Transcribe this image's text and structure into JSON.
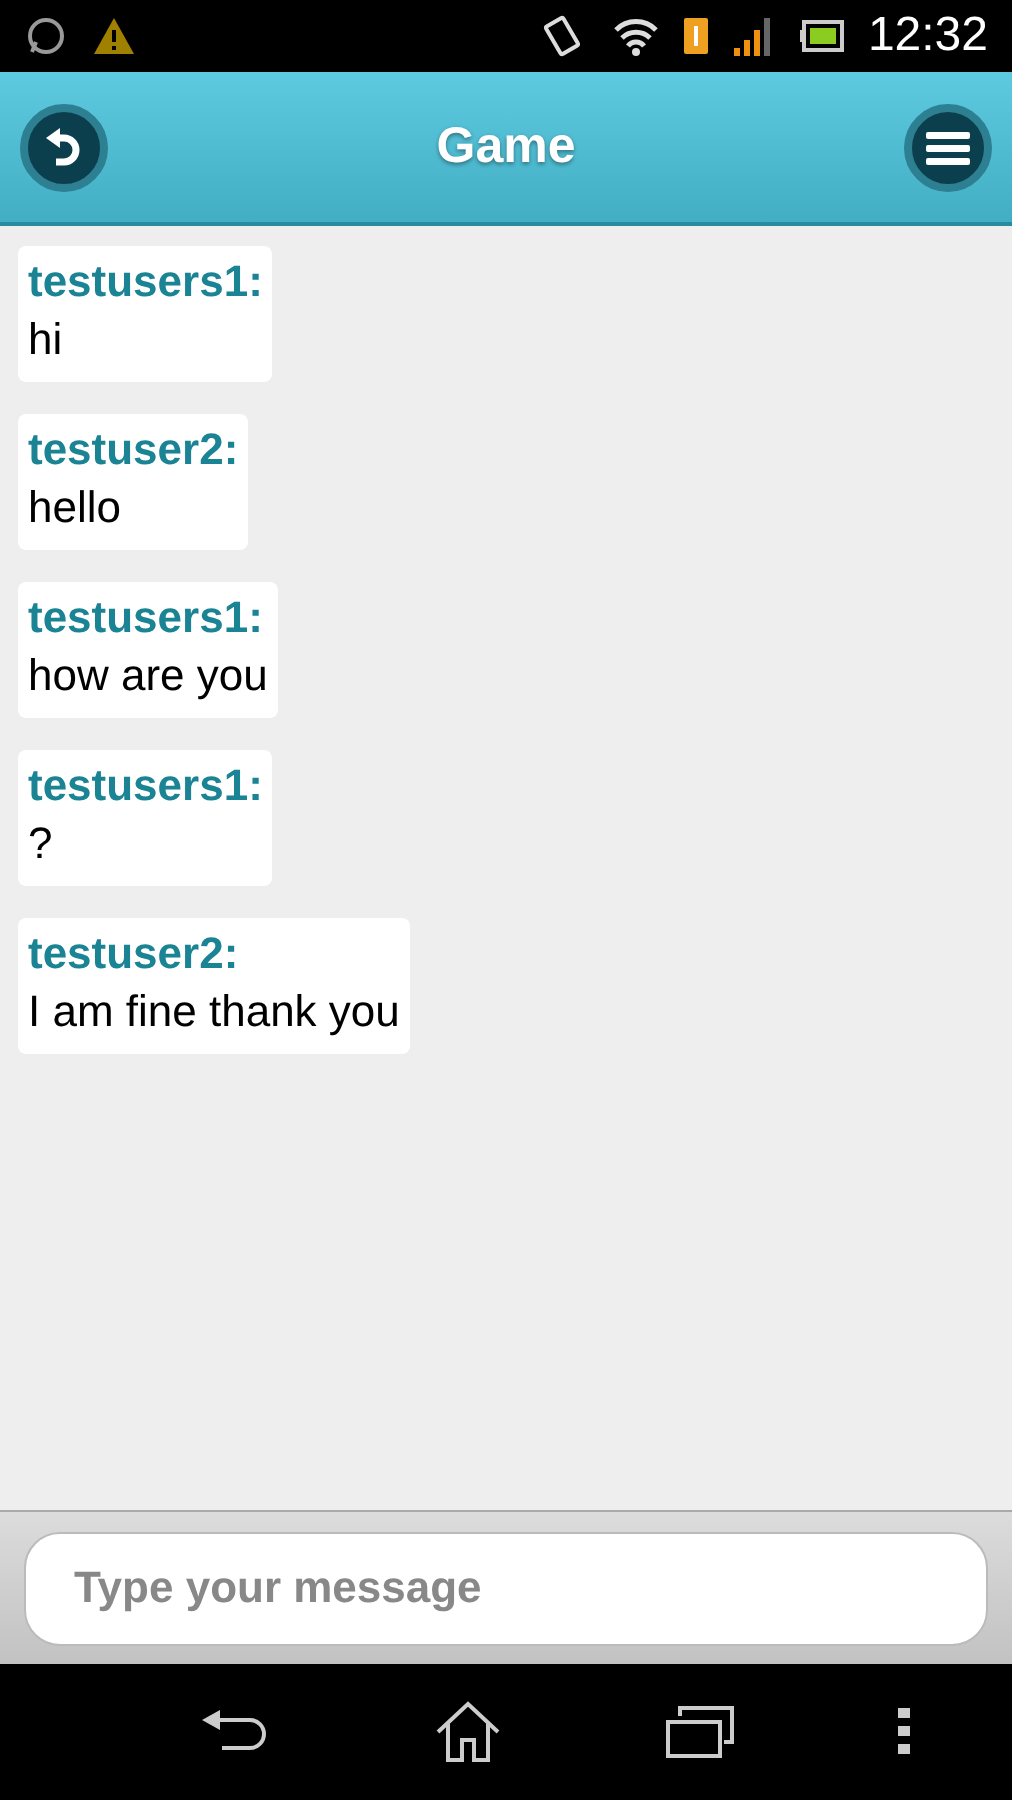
{
  "status_bar": {
    "time": "12:32"
  },
  "header": {
    "title": "Game"
  },
  "messages": [
    {
      "sender": "testusers1:",
      "text": "hi"
    },
    {
      "sender": "testuser2:",
      "text": "hello"
    },
    {
      "sender": "testusers1:",
      "text": "how are you"
    },
    {
      "sender": "testusers1:",
      "text": "?"
    },
    {
      "sender": "testuser2:",
      "text": "I am fine thank you"
    }
  ],
  "composer": {
    "placeholder": "Type your message"
  }
}
